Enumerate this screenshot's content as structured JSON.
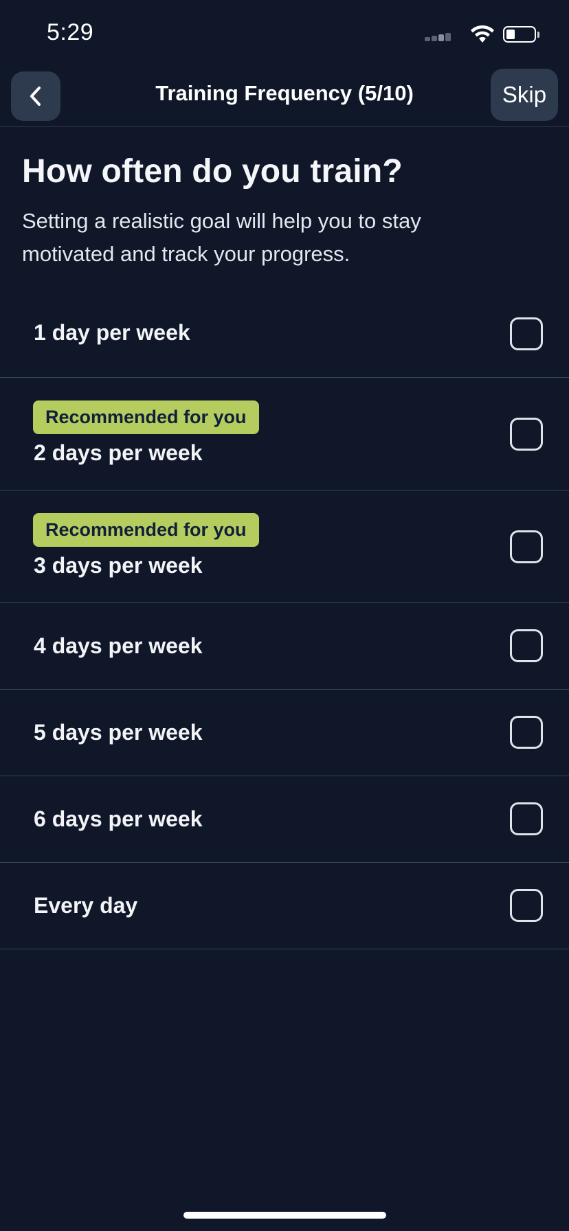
{
  "status_bar": {
    "time": "5:29",
    "icons": [
      "cellular-signal-icon",
      "wifi-icon",
      "battery-icon"
    ],
    "battery_level": 0.25
  },
  "header": {
    "back_icon": "chevron-left-icon",
    "title": "Training Frequency (5/10)",
    "skip_label": "Skip"
  },
  "main": {
    "question": "How often do you train?",
    "subtitle": "Setting a realistic goal will help you to stay motivated and track your progress.",
    "options": [
      {
        "label": "1 day per week",
        "badge": "",
        "checked": false
      },
      {
        "label": "2 days per week",
        "badge": "Recommended for you",
        "checked": false
      },
      {
        "label": "3 days per week",
        "badge": "Recommended for you",
        "checked": false
      },
      {
        "label": "4 days per week",
        "badge": "",
        "checked": false
      },
      {
        "label": "5 days per week",
        "badge": "",
        "checked": false
      },
      {
        "label": "6 days per week",
        "badge": "",
        "checked": false
      },
      {
        "label": "Every day",
        "badge": "",
        "checked": false
      }
    ]
  },
  "colors": {
    "background": "#0f1729",
    "button_bg": "#2e3b4e",
    "badge_bg": "#b5cd5f",
    "badge_text": "#11203a",
    "divider": "#3a4458",
    "checkbox_border": "#dfe4ec"
  }
}
